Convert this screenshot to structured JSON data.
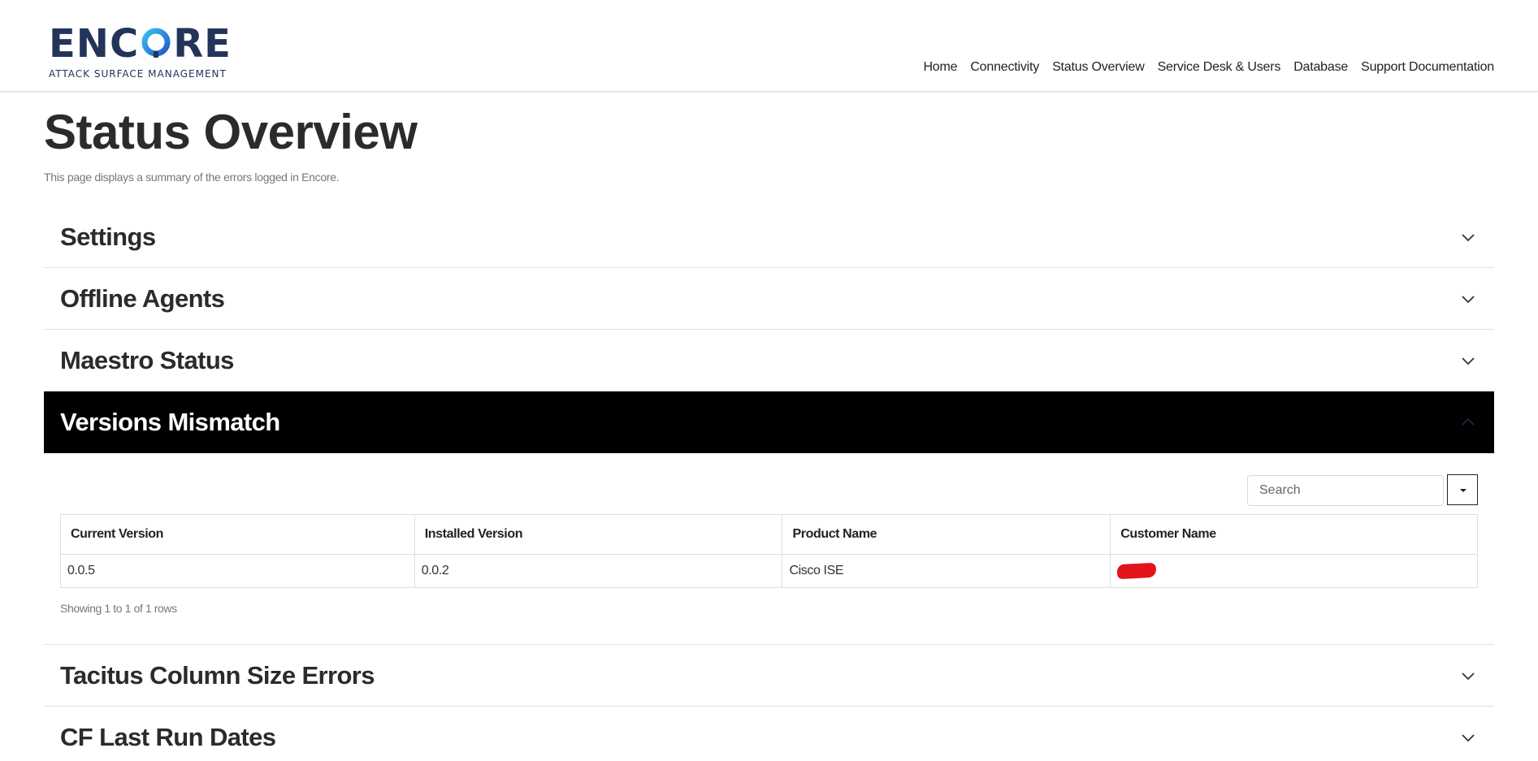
{
  "brand": {
    "name_prefix": "ENC",
    "name_suffix": "RE",
    "tagline": "ATTACK SURFACE MANAGEMENT",
    "colors": {
      "text": "#23345a",
      "accent": "#29a8e0"
    }
  },
  "nav": [
    {
      "label": "Home"
    },
    {
      "label": "Connectivity"
    },
    {
      "label": "Status Overview"
    },
    {
      "label": "Service Desk & Users"
    },
    {
      "label": "Database"
    },
    {
      "label": "Support Documentation"
    }
  ],
  "page": {
    "title": "Status Overview",
    "subtitle": "This page displays a summary of the errors logged in Encore."
  },
  "sections": {
    "settings": "Settings",
    "offline_agents": "Offline Agents",
    "maestro_status": "Maestro Status",
    "versions_mismatch": "Versions Mismatch",
    "tacitus": "Tacitus Column Size Errors",
    "cf_last_run": "CF Last Run Dates"
  },
  "versions_table": {
    "search_placeholder": "Search",
    "headers": [
      "Current Version",
      "Installed Version",
      "Product Name",
      "Customer Name"
    ],
    "rows": [
      {
        "current": "0.0.5",
        "installed": "0.0.2",
        "product": "Cisco ISE",
        "customer_redacted": true
      }
    ],
    "footer": "Showing 1 to 1 of 1 rows"
  },
  "icons": {
    "collapsed": "chevron-down-icon",
    "expanded": "chevron-up-icon",
    "dropdown": "caret-down-icon"
  },
  "colors": {
    "active_header_bg": "#000000",
    "redaction": "#e3141a"
  }
}
